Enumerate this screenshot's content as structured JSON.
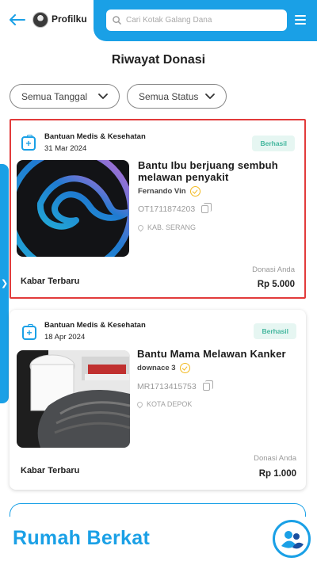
{
  "header": {
    "profile_label": "Profilku",
    "search_placeholder": "Cari Kotak Galang Dana"
  },
  "page_title": "Riwayat Donasi",
  "filters": {
    "date": "Semua Tanggal",
    "status": "Semua Status"
  },
  "donations": [
    {
      "category": "Bantuan Medis & Kesehatan",
      "date": "31 Mar 2024",
      "status": "Berhasil",
      "title": "Bantu Ibu berjuang sembuh melawan penyakit",
      "fundraiser": "Fernando Vin",
      "transaction_id": "OT1711874203",
      "location": "KAB. SERANG",
      "updates_label": "Kabar Terbaru",
      "donation_label": "Donasi Anda",
      "amount": "Rp 5.000"
    },
    {
      "category": "Bantuan Medis & Kesehatan",
      "date": "18 Apr 2024",
      "status": "Berhasil",
      "title": "Bantu Mama Melawan Kanker",
      "fundraiser": "downace 3",
      "transaction_id": "MR1713415753",
      "location": "KOTA DEPOK",
      "updates_label": "Kabar Terbaru",
      "donation_label": "Donasi Anda",
      "amount": "Rp 1.000"
    }
  ],
  "footer": {
    "brand": "Rumah Berkat"
  },
  "colors": {
    "accent": "#1aa0e6",
    "status_text": "#44b79e",
    "status_bg": "#e6f6f2",
    "verified": "#f2b91f",
    "highlight": "#e23b3b"
  }
}
